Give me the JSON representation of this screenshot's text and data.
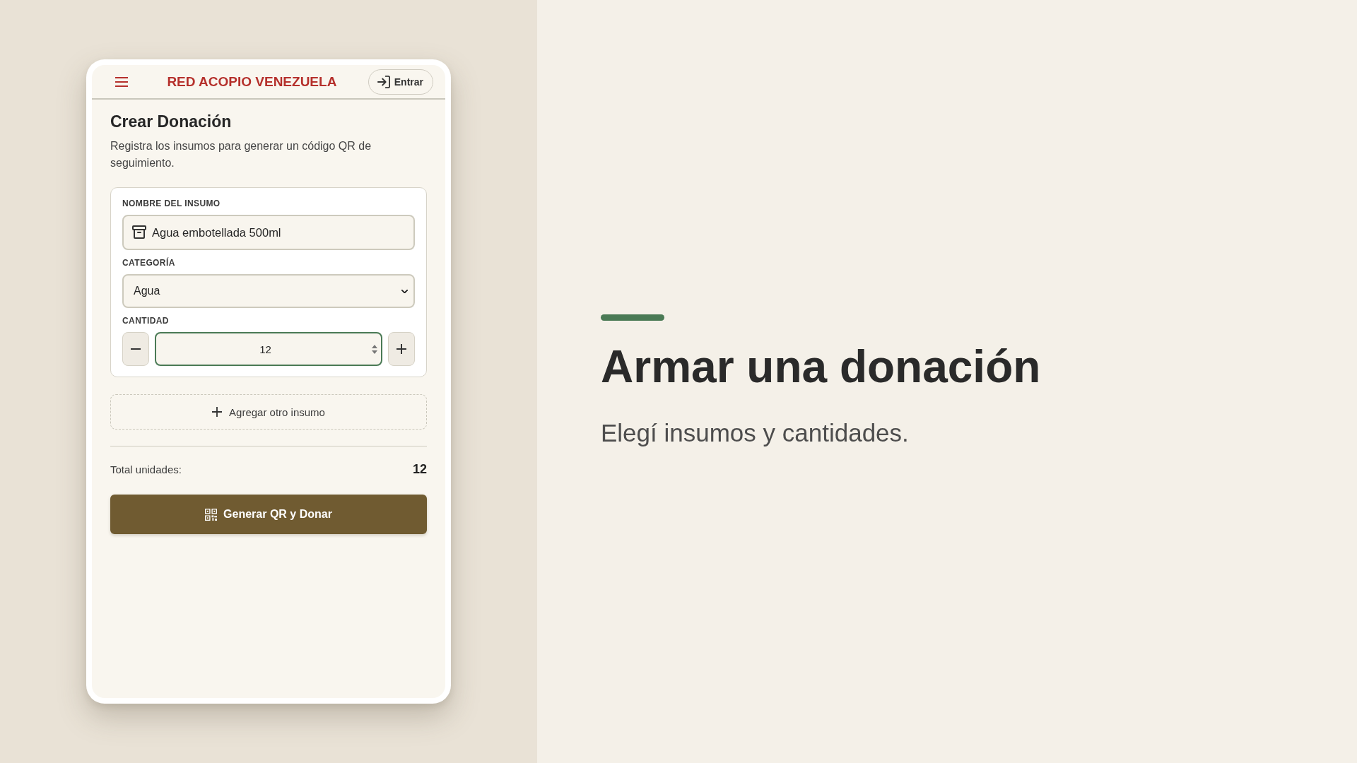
{
  "header": {
    "title": "RED ACOPIO VENEZUELA",
    "login_button": "Entrar"
  },
  "form": {
    "title": "Crear Donación",
    "description": "Registra los insumos para generar un código QR de seguimiento.",
    "items": [
      {
        "name": {
          "label": "NOMBRE DEL INSUMO",
          "value": "Agua embotellada 500ml"
        },
        "category": {
          "label": "CATEGORÍA",
          "value": "Agua"
        },
        "quantity": {
          "label": "CANTIDAD",
          "value": "12",
          "focused": true
        }
      }
    ],
    "add_item_button": "Agregar otro insumo",
    "total": {
      "label": "Total unidades:",
      "value": "12"
    },
    "submit_button": "Generar QR y Donar"
  },
  "hero": {
    "title": "Armar una donación",
    "subtitle": "Elegí insumos y cantidades."
  }
}
